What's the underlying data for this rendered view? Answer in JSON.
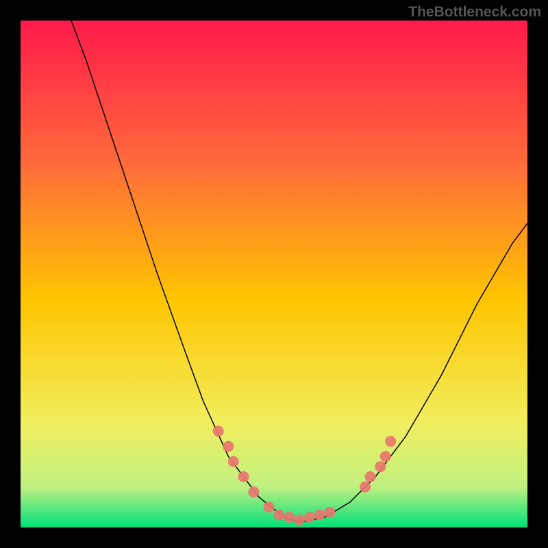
{
  "watermark": "TheBottleneck.com",
  "chart_data": {
    "type": "line",
    "title": "",
    "xlabel": "",
    "ylabel": "",
    "xlim": [
      0,
      100
    ],
    "ylim": [
      0,
      100
    ],
    "gradient_colors": {
      "top": "#ff1a4a",
      "mid": "#ffd400",
      "bottom": "#00e07a"
    },
    "series": [
      {
        "name": "curve-left",
        "stroke": "#000000",
        "stroke_width": 1.5,
        "points": [
          {
            "x": 10,
            "y": 100
          },
          {
            "x": 13,
            "y": 92
          },
          {
            "x": 17,
            "y": 80
          },
          {
            "x": 22,
            "y": 65
          },
          {
            "x": 27,
            "y": 50
          },
          {
            "x": 32,
            "y": 36
          },
          {
            "x": 36,
            "y": 25
          },
          {
            "x": 41,
            "y": 14
          },
          {
            "x": 47,
            "y": 6
          },
          {
            "x": 52,
            "y": 2
          },
          {
            "x": 55,
            "y": 1
          }
        ]
      },
      {
        "name": "curve-right",
        "stroke": "#000000",
        "stroke_width": 1.5,
        "points": [
          {
            "x": 55,
            "y": 1
          },
          {
            "x": 60,
            "y": 2
          },
          {
            "x": 65,
            "y": 5
          },
          {
            "x": 70,
            "y": 10
          },
          {
            "x": 76,
            "y": 18
          },
          {
            "x": 83,
            "y": 30
          },
          {
            "x": 90,
            "y": 44
          },
          {
            "x": 97,
            "y": 56
          },
          {
            "x": 100,
            "y": 60
          }
        ]
      },
      {
        "name": "highlight-dots",
        "stroke": "#e9766f",
        "type_hint": "scatter",
        "marker_radius": 8,
        "points": [
          {
            "x": 39,
            "y": 19
          },
          {
            "x": 41,
            "y": 16
          },
          {
            "x": 42,
            "y": 13
          },
          {
            "x": 44,
            "y": 10
          },
          {
            "x": 46,
            "y": 7
          },
          {
            "x": 49,
            "y": 4
          },
          {
            "x": 51,
            "y": 2.5
          },
          {
            "x": 53,
            "y": 2
          },
          {
            "x": 55,
            "y": 1.5
          },
          {
            "x": 57,
            "y": 2
          },
          {
            "x": 59,
            "y": 2.5
          },
          {
            "x": 61,
            "y": 3
          },
          {
            "x": 68,
            "y": 8
          },
          {
            "x": 69,
            "y": 10
          },
          {
            "x": 71,
            "y": 12
          },
          {
            "x": 72,
            "y": 14
          },
          {
            "x": 73,
            "y": 17
          }
        ]
      }
    ]
  }
}
